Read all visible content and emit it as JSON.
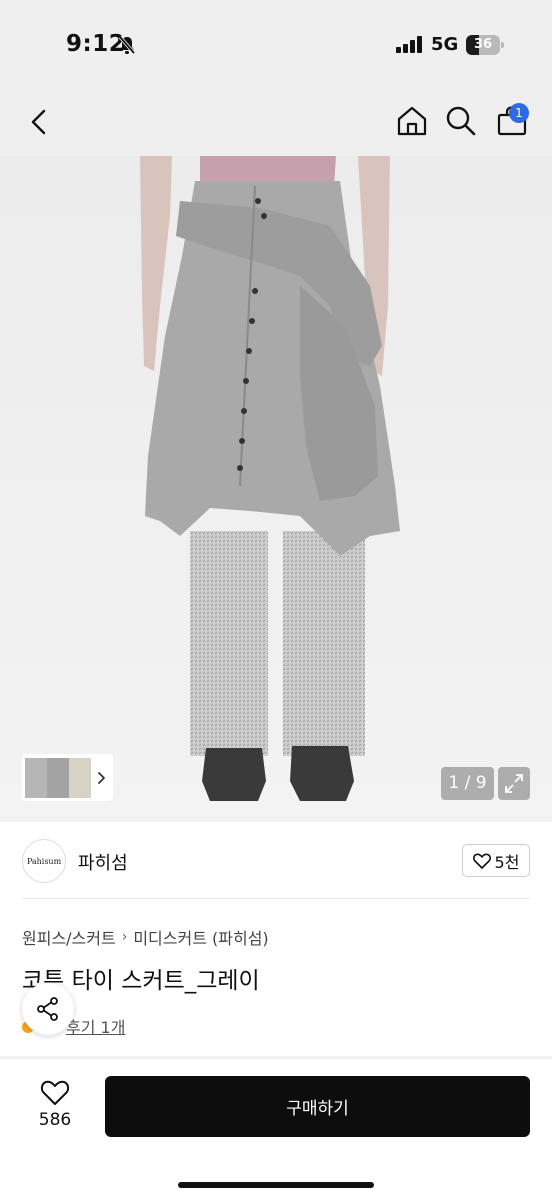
{
  "status_bar": {
    "time": "9:12",
    "network": "5G",
    "battery": "36"
  },
  "nav": {
    "cart_count": "1"
  },
  "gallery": {
    "counter": "1 / 9"
  },
  "shop": {
    "logo_text": "Pahisum",
    "name": "파히섬",
    "likes": "5천"
  },
  "product": {
    "category": "원피스/스커트",
    "subcategory": "미디스커트 (파히섬)",
    "title": "코튼 타이 스커트_그레이",
    "review_text": "후기 1개"
  },
  "bottom_bar": {
    "wish_count": "586",
    "buy_label": "구매하기"
  },
  "colors": {
    "accent_badge": "#2f6be0",
    "buy_button": "#0d0d0d",
    "background": "#efefef"
  }
}
